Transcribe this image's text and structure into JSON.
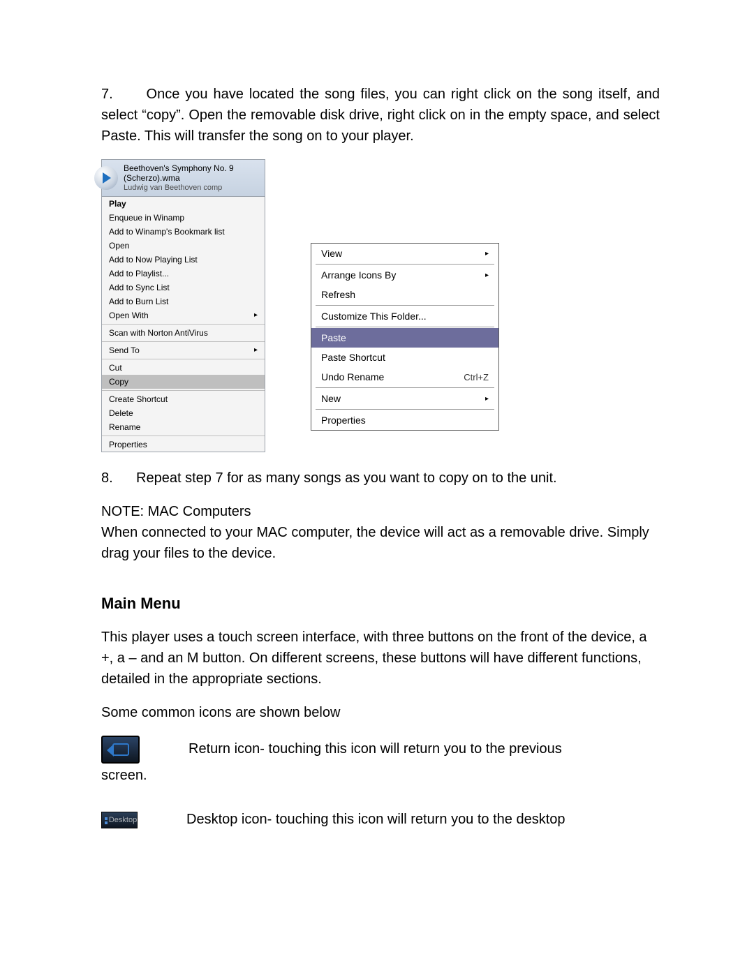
{
  "step7": {
    "number": "7.",
    "text": "Once you have located the song files, you can right click on the song itself, and select “copy”.  Open the removable disk drive, right click on in the empty space, and select Paste. This will transfer the song on to your player."
  },
  "left_menu": {
    "file_title": "Beethoven's Symphony No. 9 (Scherzo).wma",
    "file_sub": "Ludwig van Beethoven   comp",
    "items": [
      {
        "label": "Play",
        "bold": true
      },
      {
        "label": "Enqueue in Winamp"
      },
      {
        "label": "Add to Winamp's Bookmark list"
      },
      {
        "label": "Open"
      },
      {
        "label": "Add to Now Playing List"
      },
      {
        "label": "Add to Playlist..."
      },
      {
        "label": "Add to Sync List"
      },
      {
        "label": "Add to Burn List"
      },
      {
        "label": "Open With",
        "arrow": true
      },
      {
        "sep": true
      },
      {
        "label": "Scan with Norton AntiVirus"
      },
      {
        "sep": true
      },
      {
        "label": "Send To",
        "arrow": true
      },
      {
        "sep": true
      },
      {
        "label": "Cut"
      },
      {
        "label": "Copy",
        "highlight": true
      },
      {
        "sep": true
      },
      {
        "label": "Create Shortcut"
      },
      {
        "label": "Delete"
      },
      {
        "label": "Rename"
      },
      {
        "sep": true
      },
      {
        "label": "Properties"
      }
    ]
  },
  "right_menu": {
    "items": [
      {
        "label": "View",
        "arrow": true
      },
      {
        "sep": true
      },
      {
        "label": "Arrange Icons By",
        "arrow": true
      },
      {
        "label": "Refresh"
      },
      {
        "sep": true
      },
      {
        "label": "Customize This Folder..."
      },
      {
        "sep": true
      },
      {
        "label": "Paste",
        "highlight": true
      },
      {
        "label": "Paste Shortcut"
      },
      {
        "label": "Undo Rename",
        "shortcut": "Ctrl+Z"
      },
      {
        "sep": true
      },
      {
        "label": "New",
        "arrow": true
      },
      {
        "sep": true
      },
      {
        "label": "Properties"
      }
    ]
  },
  "step8": {
    "number": "8.",
    "text": "Repeat step 7 for as many songs as you want to copy on to the unit."
  },
  "note": {
    "heading": "NOTE: MAC Computers",
    "body": "When connected to your MAC computer, the device will act as a removable drive. Simply drag your files to the device."
  },
  "main_menu": {
    "heading": "Main Menu",
    "para1": "This player uses a touch screen interface, with three buttons on the front of the device, a +, a – and an M button. On different screens, these buttons will have different functions, detailed in the appropriate sections.",
    "para2": "Some common icons are shown below"
  },
  "return_icon": {
    "line1": "Return icon- touching this icon will return you to the previous",
    "line2": "screen."
  },
  "desktop_icon": {
    "label": "Desktop",
    "text": "Desktop icon- touching this icon will return you to the desktop"
  }
}
